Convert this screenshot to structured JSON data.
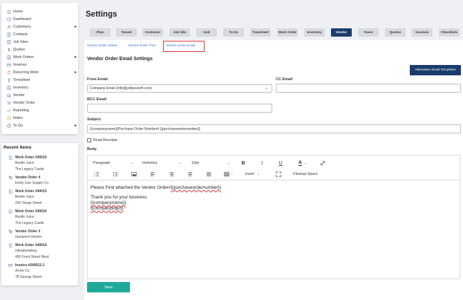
{
  "sidebar": {
    "items": [
      {
        "label": "Home",
        "icon": "home-icon",
        "chevron": false
      },
      {
        "label": "Dashboard",
        "icon": "dashboard-icon",
        "chevron": false
      },
      {
        "label": "Customers",
        "icon": "customers-icon",
        "chevron": true
      },
      {
        "label": "Contacts",
        "icon": "contacts-icon",
        "chevron": false
      },
      {
        "label": "Job Sites",
        "icon": "job-sites-icon",
        "chevron": false
      },
      {
        "label": "Quotes",
        "icon": "quotes-icon",
        "chevron": false
      },
      {
        "label": "Work Orders",
        "icon": "work-orders-icon",
        "chevron": true
      },
      {
        "label": "Invoices",
        "icon": "invoices-icon",
        "chevron": false
      },
      {
        "label": "Recurring Work",
        "icon": "recurring-work-icon",
        "chevron": true
      },
      {
        "label": "Timesheet",
        "icon": "timesheet-icon",
        "chevron": false
      },
      {
        "label": "Inventory",
        "icon": "inventory-icon",
        "chevron": false
      },
      {
        "label": "Vendor",
        "icon": "vendor-icon",
        "chevron": false
      },
      {
        "label": "Vendor Order",
        "icon": "vendor-order-icon",
        "chevron": false
      },
      {
        "label": "Reporting",
        "icon": "reporting-icon",
        "chevron": false
      },
      {
        "label": "Notes",
        "icon": "notes-icon",
        "chevron": false
      },
      {
        "label": "To Do",
        "icon": "todo-icon",
        "chevron": true
      }
    ]
  },
  "recent": {
    "title": "Recent Items",
    "entries": [
      {
        "title": "Work Order 240015",
        "icon": "document-icon",
        "lines": [
          "Beetle Juice",
          "The Legacy Castle"
        ]
      },
      {
        "title": "Vendor Order 4",
        "icon": "cart-icon",
        "lines": [
          "Emily Carr Supply Co."
        ]
      },
      {
        "title": "Work Order 240013",
        "icon": "document-icon",
        "lines": [
          "Beetle Juice",
          "220 Yonge Street"
        ]
      },
      {
        "title": "Work Order 240010",
        "icon": "document-icon",
        "lines": [
          "Beetle Juice",
          "The Legacy Castle"
        ]
      },
      {
        "title": "Vendor Order 3",
        "icon": "cart-icon",
        "lines": [
          "manpreet Vendor"
        ]
      },
      {
        "title": "Work Order 240014",
        "icon": "document-icon",
        "lines": [
          "mikeplumbing",
          "450 Front Street West"
        ]
      },
      {
        "title": "Invoice #240012-1",
        "icon": "invoice-icon",
        "lines": [
          "Acme Co.",
          "78 George Street"
        ]
      }
    ]
  },
  "page": {
    "title": "Settings"
  },
  "tabs": [
    {
      "label": "Plan",
      "active": false
    },
    {
      "label": "Tenant",
      "active": false
    },
    {
      "label": "Customer",
      "active": false
    },
    {
      "label": "Job Site",
      "active": false
    },
    {
      "label": "Unit",
      "active": false
    },
    {
      "label": "To Do",
      "active": false
    },
    {
      "label": "Timesheet",
      "active": false
    },
    {
      "label": "Work Order",
      "active": false
    },
    {
      "label": "Inventory",
      "active": false
    },
    {
      "label": "Vendor",
      "active": true
    },
    {
      "label": "Taxes",
      "active": false
    },
    {
      "label": "Quotes",
      "active": false
    },
    {
      "label": "Invoices",
      "active": false
    },
    {
      "label": "Checklists",
      "active": false
    }
  ],
  "subtabs": [
    {
      "label": "Vendor Order Status",
      "active": false
    },
    {
      "label": "Vendor Order Print",
      "active": false
    },
    {
      "label": "Vendor Order Email",
      "active": true
    }
  ],
  "section": {
    "title": "Vendor Order Email Settings",
    "alt_templates_button": "Alternative Email Templates"
  },
  "form": {
    "from_email_label": "From Email",
    "from_email_value": "Company Email (info@jobboxsoft.com)",
    "cc_email_label": "CC Email",
    "cc_email_value": "",
    "bcc_email_label": "BCC Email",
    "bcc_email_value": "",
    "subject_label": "Subject",
    "subject_value": "{{companyname}}Purchase Order Number# {{purchaseordernumber}}",
    "read_receipts_label": "Read Receipts",
    "read_receipts_checked": false,
    "body_label": "Body"
  },
  "editor": {
    "block_format": "Paragraph",
    "font_family": "Helvetica",
    "font_size": "15px",
    "insert_label": "insert",
    "cleanup_label": "Cleanup Space",
    "body_line1_prefix": "Please Find attached the Vendor Order#",
    "body_line1_token": "{{purchaseordernumber}}",
    "body_line2": "Thank you for your business",
    "body_line3": "{{companyname}}",
    "body_line4": "{{companylogo}}"
  },
  "save_button": "Save",
  "colors": {
    "active_tab": "#1a3d6d",
    "save_button": "#1fa99a",
    "link": "#3a6fc4",
    "highlight_border": "#d33333"
  }
}
